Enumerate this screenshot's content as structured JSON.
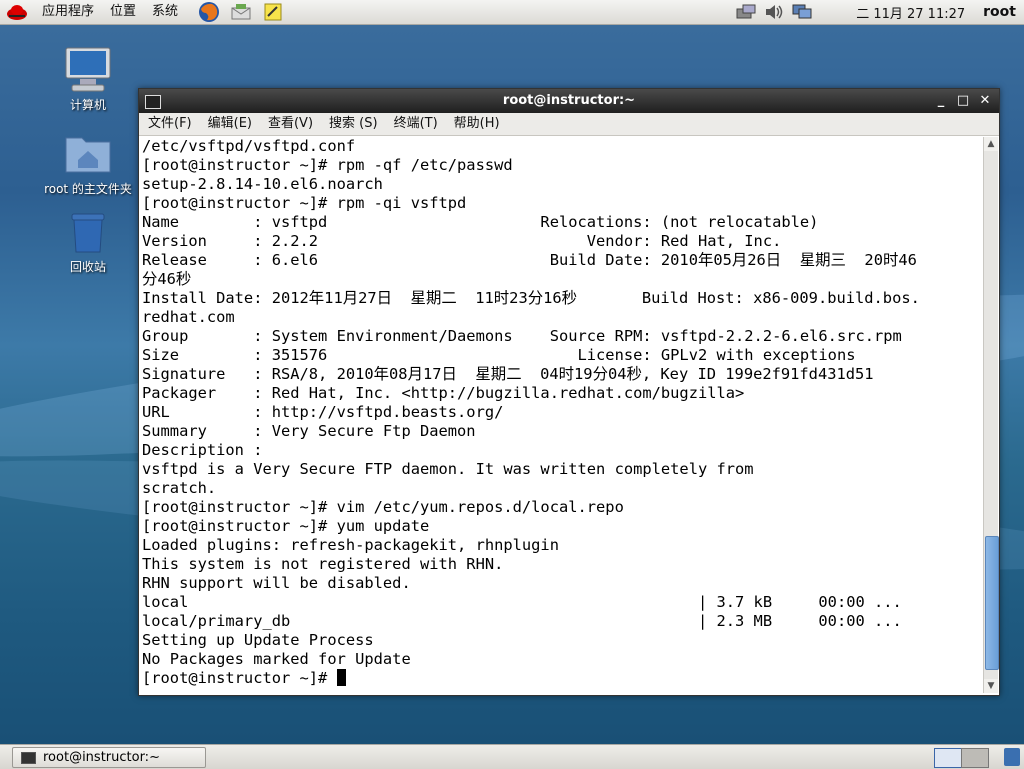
{
  "top_panel": {
    "menus": [
      "应用程序",
      "位置",
      "系统"
    ],
    "clock": "二 11月 27 11:27",
    "user": "root"
  },
  "desktop": {
    "icons": [
      {
        "label": "计算机",
        "icon": "computer-icon"
      },
      {
        "label": "root 的主文件夹",
        "icon": "home-folder-icon"
      },
      {
        "label": "回收站",
        "icon": "trash-icon"
      }
    ]
  },
  "terminal": {
    "title": "root@instructor:~",
    "menus": [
      "文件(F)",
      "编辑(E)",
      "查看(V)",
      "搜索 (S)",
      "终端(T)",
      "帮助(H)"
    ],
    "lines": [
      "/etc/vsftpd/vsftpd.conf",
      "[root@instructor ~]# rpm -qf /etc/passwd",
      "setup-2.8.14-10.el6.noarch",
      "[root@instructor ~]# rpm -qi vsftpd",
      "Name        : vsftpd                       Relocations: (not relocatable)",
      "Version     : 2.2.2                             Vendor: Red Hat, Inc.",
      "Release     : 6.el6                         Build Date: 2010年05月26日  星期三  20时46",
      "分46秒",
      "Install Date: 2012年11月27日  星期二  11时23分16秒       Build Host: x86-009.build.bos.",
      "redhat.com",
      "Group       : System Environment/Daemons    Source RPM: vsftpd-2.2.2-6.el6.src.rpm",
      "Size        : 351576                           License: GPLv2 with exceptions",
      "Signature   : RSA/8, 2010年08月17日  星期二  04时19分04秒, Key ID 199e2f91fd431d51",
      "Packager    : Red Hat, Inc. <http://bugzilla.redhat.com/bugzilla>",
      "URL         : http://vsftpd.beasts.org/",
      "Summary     : Very Secure Ftp Daemon",
      "Description :",
      "vsftpd is a Very Secure FTP daemon. It was written completely from",
      "scratch.",
      "[root@instructor ~]# vim /etc/yum.repos.d/local.repo",
      "[root@instructor ~]# yum update",
      "Loaded plugins: refresh-packagekit, rhnplugin",
      "This system is not registered with RHN.",
      "RHN support will be disabled.",
      "local                                                       | 3.7 kB     00:00 ...",
      "local/primary_db                                            | 2.3 MB     00:00 ...",
      "Setting up Update Process",
      "No Packages marked for Update"
    ],
    "prompt": "[root@instructor ~]# ",
    "scroll": {
      "thumb_start": 0.73,
      "thumb_size": 0.25
    }
  },
  "bottom_panel": {
    "task_label": "root@instructor:~"
  }
}
